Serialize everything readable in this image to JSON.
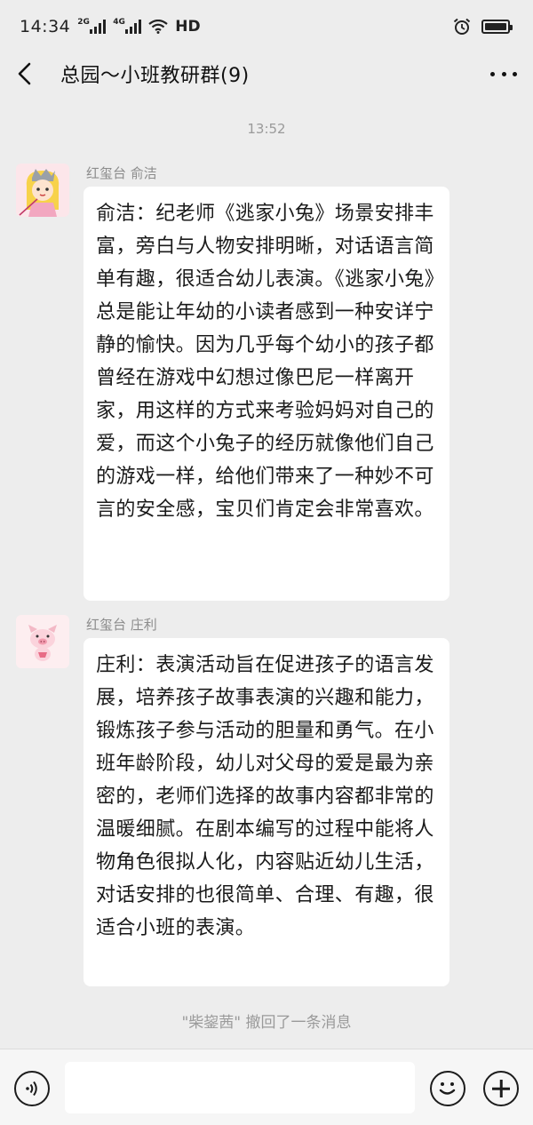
{
  "status_bar": {
    "time": "14:34",
    "signal1_label": "2G",
    "signal2_label": "4G",
    "network_label": "HD",
    "icons": [
      "signal-icon",
      "signal-icon",
      "wifi-icon",
      "alarm-icon",
      "battery-icon"
    ]
  },
  "header": {
    "title": "总园～小班教研群(9)",
    "back_icon": "chevron-left-icon",
    "more_icon": "more-dots-icon"
  },
  "chat": {
    "timestamp": "13:52",
    "messages": [
      {
        "sender": "红玺台 俞洁",
        "avatar": "avatar-girl-illustration",
        "text": "俞洁：纪老师《逃家小兔》场景安排丰富，旁白与人物安排明晰，对话语言简单有趣，很适合幼儿表演。《逃家小兔》总是能让年幼的小读者感到一种安详宁静的愉快。因为几乎每个幼小的孩子都曾经在游戏中幻想过像巴尼一样离开家，用这样的方式来考验妈妈对自己的爱，而这个小兔子的经历就像他们自己的游戏一样，给他们带来了一种妙不可言的安全感，宝贝们肯定会非常喜欢。"
      },
      {
        "sender": "红玺台 庄利",
        "avatar": "avatar-pig-illustration",
        "text": "庄利：表演活动旨在促进孩子的语言发展，培养孩子故事表演的兴趣和能力，锻炼孩子参与活动的胆量和勇气。在小班年龄阶段，幼儿对父母的爱是最为亲密的，老师们选择的故事内容都非常的温暖细腻。在剧本编写的过程中能将人物角色很拟人化，内容贴近幼儿生活，对话安排的也很简单、合理、有趣，很适合小班的表演。"
      }
    ],
    "recall_notice": "\"柴鋆茜\" 撤回了一条消息"
  },
  "input_bar": {
    "placeholder": "",
    "voice_icon": "voice-icon",
    "emoji_icon": "emoji-icon",
    "plus_icon": "plus-icon"
  }
}
